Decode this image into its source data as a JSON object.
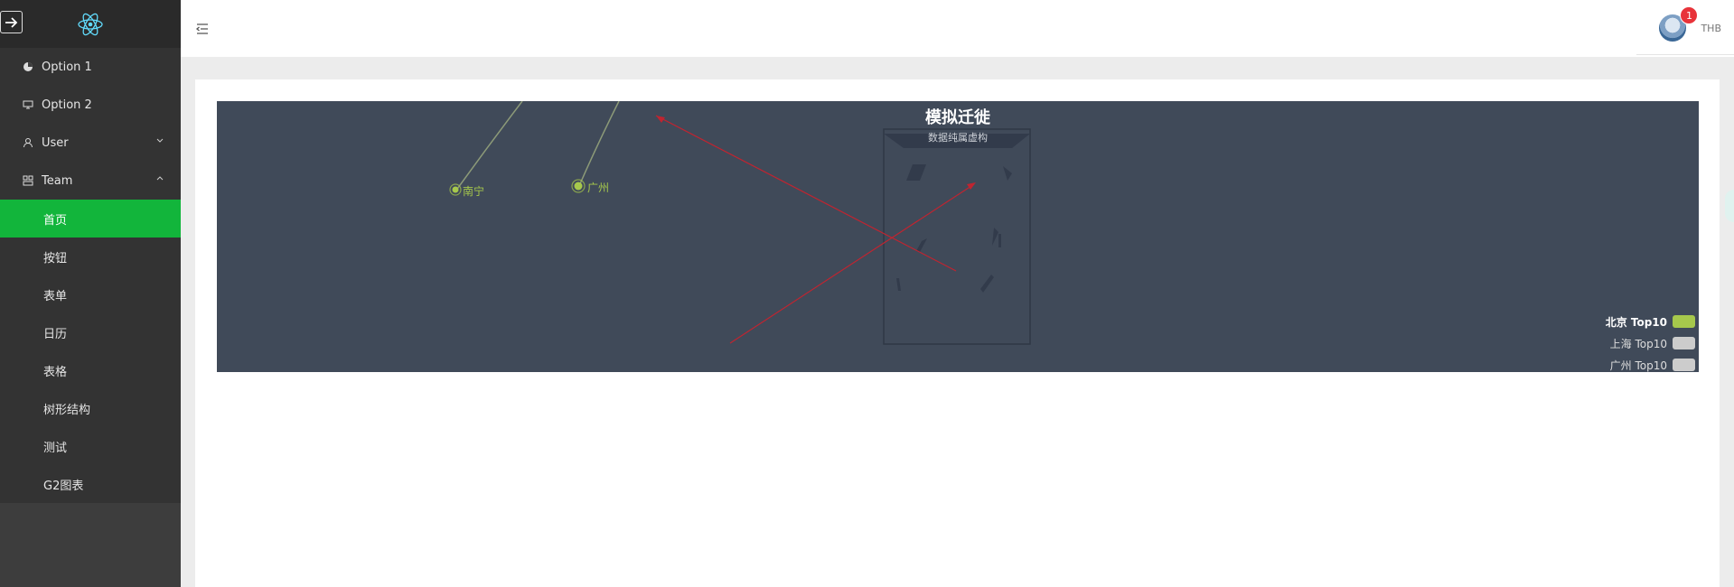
{
  "sidebar": {
    "items": [
      {
        "label": "Option 1",
        "icon": "pie-chart-icon"
      },
      {
        "label": "Option 2",
        "icon": "desktop-icon"
      },
      {
        "label": "User",
        "icon": "user-icon",
        "expanded": false
      },
      {
        "label": "Team",
        "icon": "team-icon",
        "expanded": true
      }
    ],
    "submenu": [
      "首页",
      "按钮",
      "表单",
      "日历",
      "表格",
      "树形结构",
      "测试",
      "G2图表"
    ],
    "active_sub": "首页"
  },
  "header": {
    "username": "THB",
    "notification_count": "1"
  },
  "map": {
    "title": "模拟迁徙",
    "subtitle": "数据纯属虚构",
    "cities": [
      "南宁",
      "广州"
    ],
    "legend": [
      {
        "label": "北京 Top10",
        "active": true
      },
      {
        "label": "上海 Top10",
        "active": false
      },
      {
        "label": "广州 Top10",
        "active": false
      }
    ]
  },
  "colors": {
    "active_menu": "#12b53b",
    "map_bg": "#404a59",
    "beijing_series": "#a6c84c",
    "flow_line": "#c02430",
    "badge": "#e8333a"
  }
}
